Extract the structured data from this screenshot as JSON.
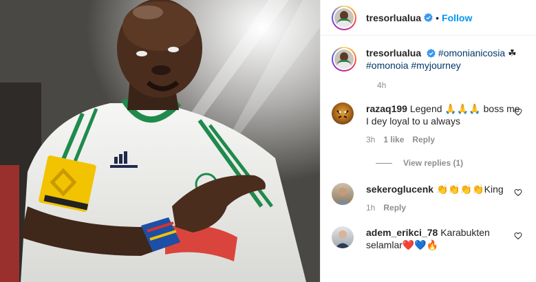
{
  "post": {
    "username": "tresorlualua",
    "separator": "•",
    "follow_label": "Follow"
  },
  "caption": {
    "username": "tresorlualua",
    "hashtag1": "#omonianicosia",
    "clover": "☘",
    "hashtag2": "#omonoia",
    "hashtag3": "#myjourney",
    "time": "4h"
  },
  "comments": [
    {
      "username": "razaq199",
      "text": "Legend 🙏🙏🙏 boss me I dey loyal to u always",
      "time": "3h",
      "likes": "1 like",
      "reply_label": "Reply",
      "view_replies": "View replies (1)"
    },
    {
      "username": "sekeroglucenk",
      "text": "👏👏👏👏King",
      "time": "1h",
      "reply_label": "Reply"
    },
    {
      "username": "adem_erikci_78",
      "text": "Karabukten selamlar❤️💙🔥"
    }
  ],
  "colors": {
    "accent": "#0095f6",
    "hashtag": "#00376b",
    "muted": "#8e8e8e",
    "jersey_green": "#1f8a4c"
  }
}
